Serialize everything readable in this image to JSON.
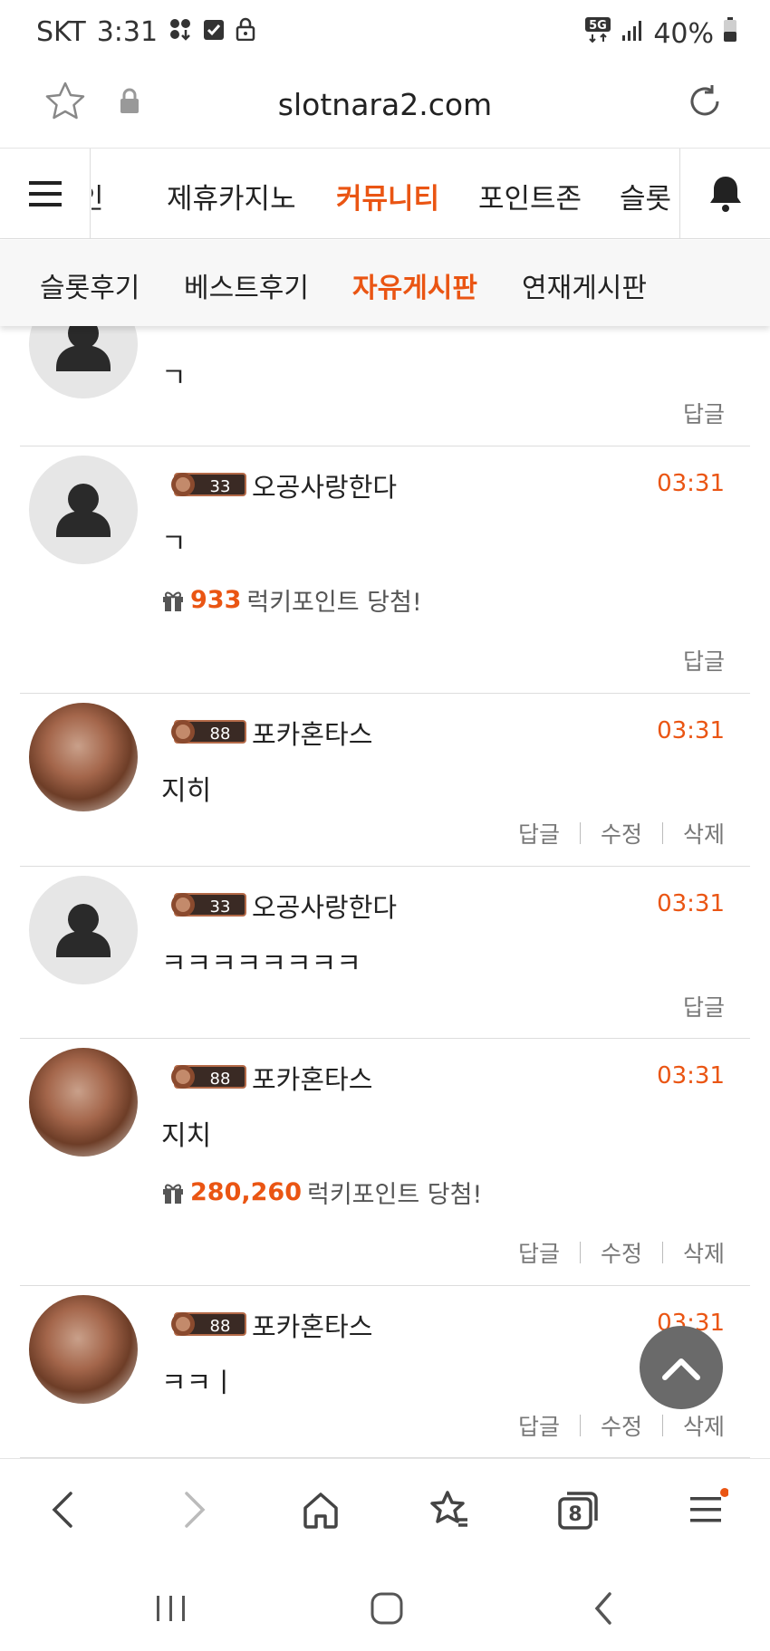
{
  "status_bar": {
    "carrier": "SKT",
    "time": "3:31",
    "network": "5G",
    "battery": "40%"
  },
  "url_bar": {
    "url": "slotnara2.com",
    "icons": [
      "star-icon",
      "lock-icon",
      "reload-icon"
    ]
  },
  "main_nav": {
    "items": [
      {
        "label": "인"
      },
      {
        "label": "제휴카지노"
      },
      {
        "label": "커뮤니티",
        "active": true
      },
      {
        "label": "포인트존"
      },
      {
        "label": "슬롯"
      }
    ]
  },
  "sub_nav": {
    "items": [
      {
        "label": "슬롯후기"
      },
      {
        "label": "베스트후기"
      },
      {
        "label": "자유게시판",
        "active": true
      },
      {
        "label": "연재게시판"
      }
    ]
  },
  "comments": [
    {
      "avatar": "default",
      "text": "ㄱ",
      "actions": [
        "답글"
      ]
    },
    {
      "avatar": "default",
      "level": "33",
      "nick": "오공사랑한다",
      "time": "03:31",
      "text": "ㄱ",
      "lucky_points": "933",
      "lucky_text": "럭키포인트 당첨!",
      "actions": [
        "답글"
      ]
    },
    {
      "avatar": "photo",
      "level": "88",
      "nick": "포카혼타스",
      "time": "03:31",
      "text": "지히",
      "actions": [
        "답글",
        "수정",
        "삭제"
      ]
    },
    {
      "avatar": "default",
      "level": "33",
      "nick": "오공사랑한다",
      "time": "03:31",
      "text": "ㅋㅋㅋㅋㅋㅋㅋㅋ",
      "actions": [
        "답글"
      ]
    },
    {
      "avatar": "photo",
      "level": "88",
      "nick": "포카혼타스",
      "time": "03:31",
      "text": "지치",
      "lucky_points": "280,260",
      "lucky_text": "럭키포인트 당첨!",
      "actions": [
        "답글",
        "수정",
        "삭제"
      ]
    },
    {
      "avatar": "photo",
      "level": "88",
      "nick": "포카혼타스",
      "time": "03:31",
      "text": "ㅋㅋㅣ",
      "actions": [
        "답글",
        "수정",
        "삭제"
      ]
    }
  ],
  "browser_nav": {
    "tab_count": "8",
    "icons": [
      "back-icon",
      "forward-icon",
      "home-icon",
      "bookmarks-icon",
      "tabs-icon",
      "menu-icon"
    ]
  },
  "colors": {
    "accent": "#ea5513",
    "fab": "#6a6a6a"
  }
}
